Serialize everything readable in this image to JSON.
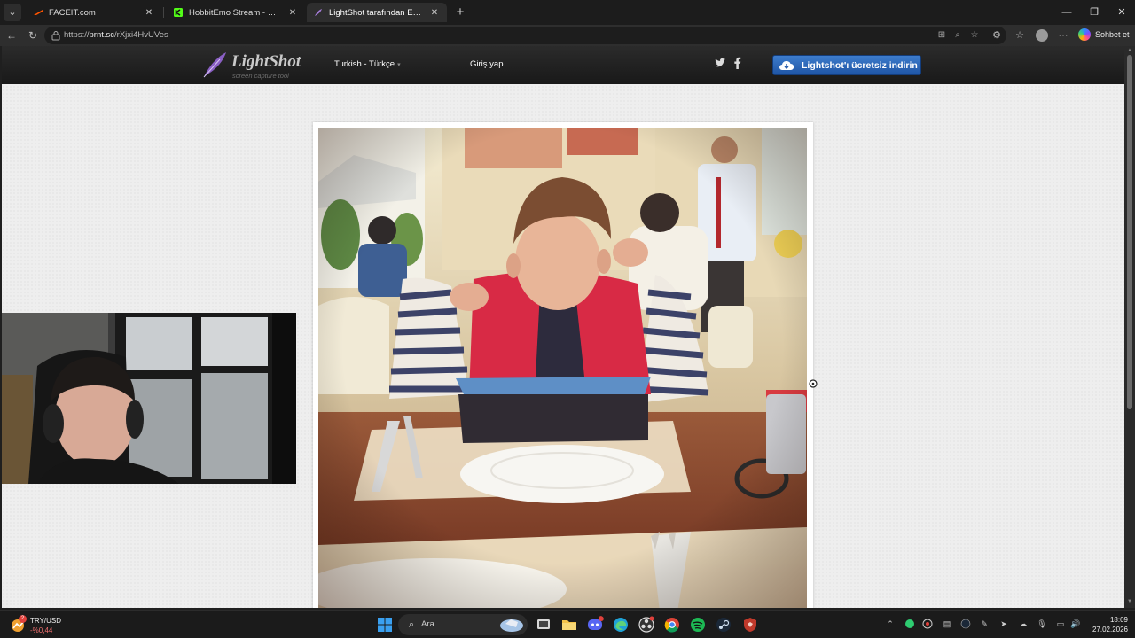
{
  "tabs": [
    {
      "title": "FACEIT.com",
      "icon": "faceit-icon",
      "active": false
    },
    {
      "title": "HobbitEmo Stream - Watch Live on Kick",
      "icon": "kick-icon",
      "active": false
    },
    {
      "title": "LightShot tarafından Ekran Görüntüsü",
      "icon": "lightshot-icon",
      "active": true
    }
  ],
  "address": {
    "prefix": "https://",
    "host": "prnt.sc",
    "path": "/rXjxi4HvUVes"
  },
  "copilot_label": "Sohbet et",
  "site": {
    "brand": "LightShot",
    "tagline": "screen capture tool",
    "language": "Turkish - Türkçe",
    "login": "Giriş yap",
    "download": "Lightshot'ı ücretsiz indirin"
  },
  "taskbar": {
    "widget_title": "TRY/USD",
    "widget_value": "-%0,44",
    "widget_badge": "2",
    "search_placeholder": "Ara",
    "time": "18:09",
    "date": "27.02.2026"
  },
  "colors": {
    "accent": "#2f6ab8",
    "page_bg": "#eeeeee",
    "header_bg": "#1f1f1f"
  }
}
